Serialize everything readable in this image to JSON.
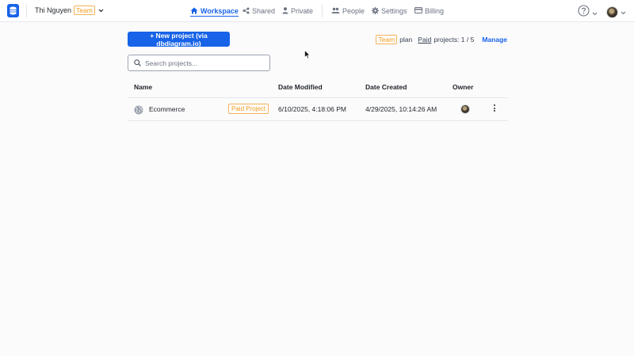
{
  "header": {
    "user_name": "Thi Nguyen",
    "team_badge": "Team",
    "nav": [
      {
        "label": "Workspace",
        "icon": "home-icon",
        "active": true
      },
      {
        "label": "Shared",
        "icon": "share-icon"
      },
      {
        "label": "Private",
        "icon": "person-icon"
      },
      {
        "label": "People",
        "icon": "people-icon"
      },
      {
        "label": "Settings",
        "icon": "gear-icon"
      },
      {
        "label": "Billing",
        "icon": "card-icon"
      }
    ],
    "help_icon": "question-circle-icon"
  },
  "toolbar": {
    "new_project_label": "+ New project (via dbdiagram.io)",
    "plan_badge": "Team",
    "plan_text": "plan",
    "paid_label": "Paid",
    "projects_count_label": "projects: 1 / 5",
    "manage_label": "Manage"
  },
  "search": {
    "placeholder": "Search projects..."
  },
  "table": {
    "columns": [
      "Name",
      "Date Modified",
      "Date Created",
      "Owner"
    ],
    "rows": [
      {
        "name": "Ecommerce",
        "badge": "Paid Project",
        "date_modified": "6/10/2025, 4:18:06 PM",
        "date_created": "4/29/2025, 10:14:26 AM",
        "icon": "globe-icon"
      }
    ]
  },
  "colors": {
    "accent": "#1863e8",
    "badge": "#f19a1a"
  }
}
